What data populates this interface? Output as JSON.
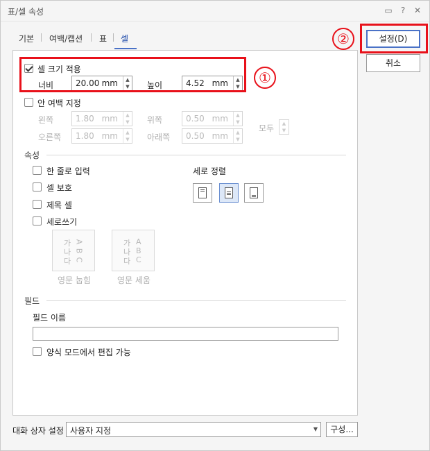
{
  "window": {
    "title": "표/셀 속성"
  },
  "titlebar_icons": [
    "chat-icon",
    "help-icon",
    "close-icon"
  ],
  "titlebar_glyphs": {
    "chat": "▭",
    "help": "?",
    "close": "✕"
  },
  "tabs": [
    {
      "label": "기본"
    },
    {
      "label": "여백/캡션"
    },
    {
      "label": "표"
    },
    {
      "label": "셀",
      "active": true
    }
  ],
  "buttons": {
    "ok": "설정(D)",
    "cancel": "취소",
    "config": "구성..."
  },
  "cell_size": {
    "apply_label": "셀 크기 적용",
    "apply_checked": true,
    "width_label": "너비",
    "width_value": "20.00",
    "height_label": "높이",
    "height_value": "4.52",
    "unit": "mm"
  },
  "inner_margin": {
    "label": "안 여백 지정",
    "checked": false,
    "left_label": "왼쪽",
    "left_value": "1.80",
    "right_label": "오른쪽",
    "right_value": "1.80",
    "top_label": "위쪽",
    "top_value": "0.50",
    "bottom_label": "아래쪽",
    "bottom_value": "0.50",
    "all_label": "모두",
    "unit": "mm"
  },
  "properties": {
    "section_title": "속성",
    "single_line": "한 줄로 입력",
    "protect": "셀 보호",
    "title_cell": "제목 셀",
    "vertical_writing": "세로쓰기",
    "vertical_align_label": "세로 정렬",
    "latin_lying_label": "영문 눕힘",
    "latin_standing_label": "영문 세움",
    "sample_korean": [
      "가",
      "나",
      "다"
    ],
    "sample_latin": [
      "A",
      "B",
      "C"
    ]
  },
  "field": {
    "section_title": "필드",
    "name_label": "필드 이름",
    "name_value": "",
    "editable_label": "양식 모드에서 편집 가능"
  },
  "footer": {
    "dialog_settings_label": "대화 상자 설정",
    "dialog_settings_value": "사용자 지정"
  },
  "annotations": {
    "marker1": "①",
    "marker2": "②"
  },
  "colors": {
    "annotation_red": "#e8111a",
    "accent_blue": "#4a72c7"
  }
}
